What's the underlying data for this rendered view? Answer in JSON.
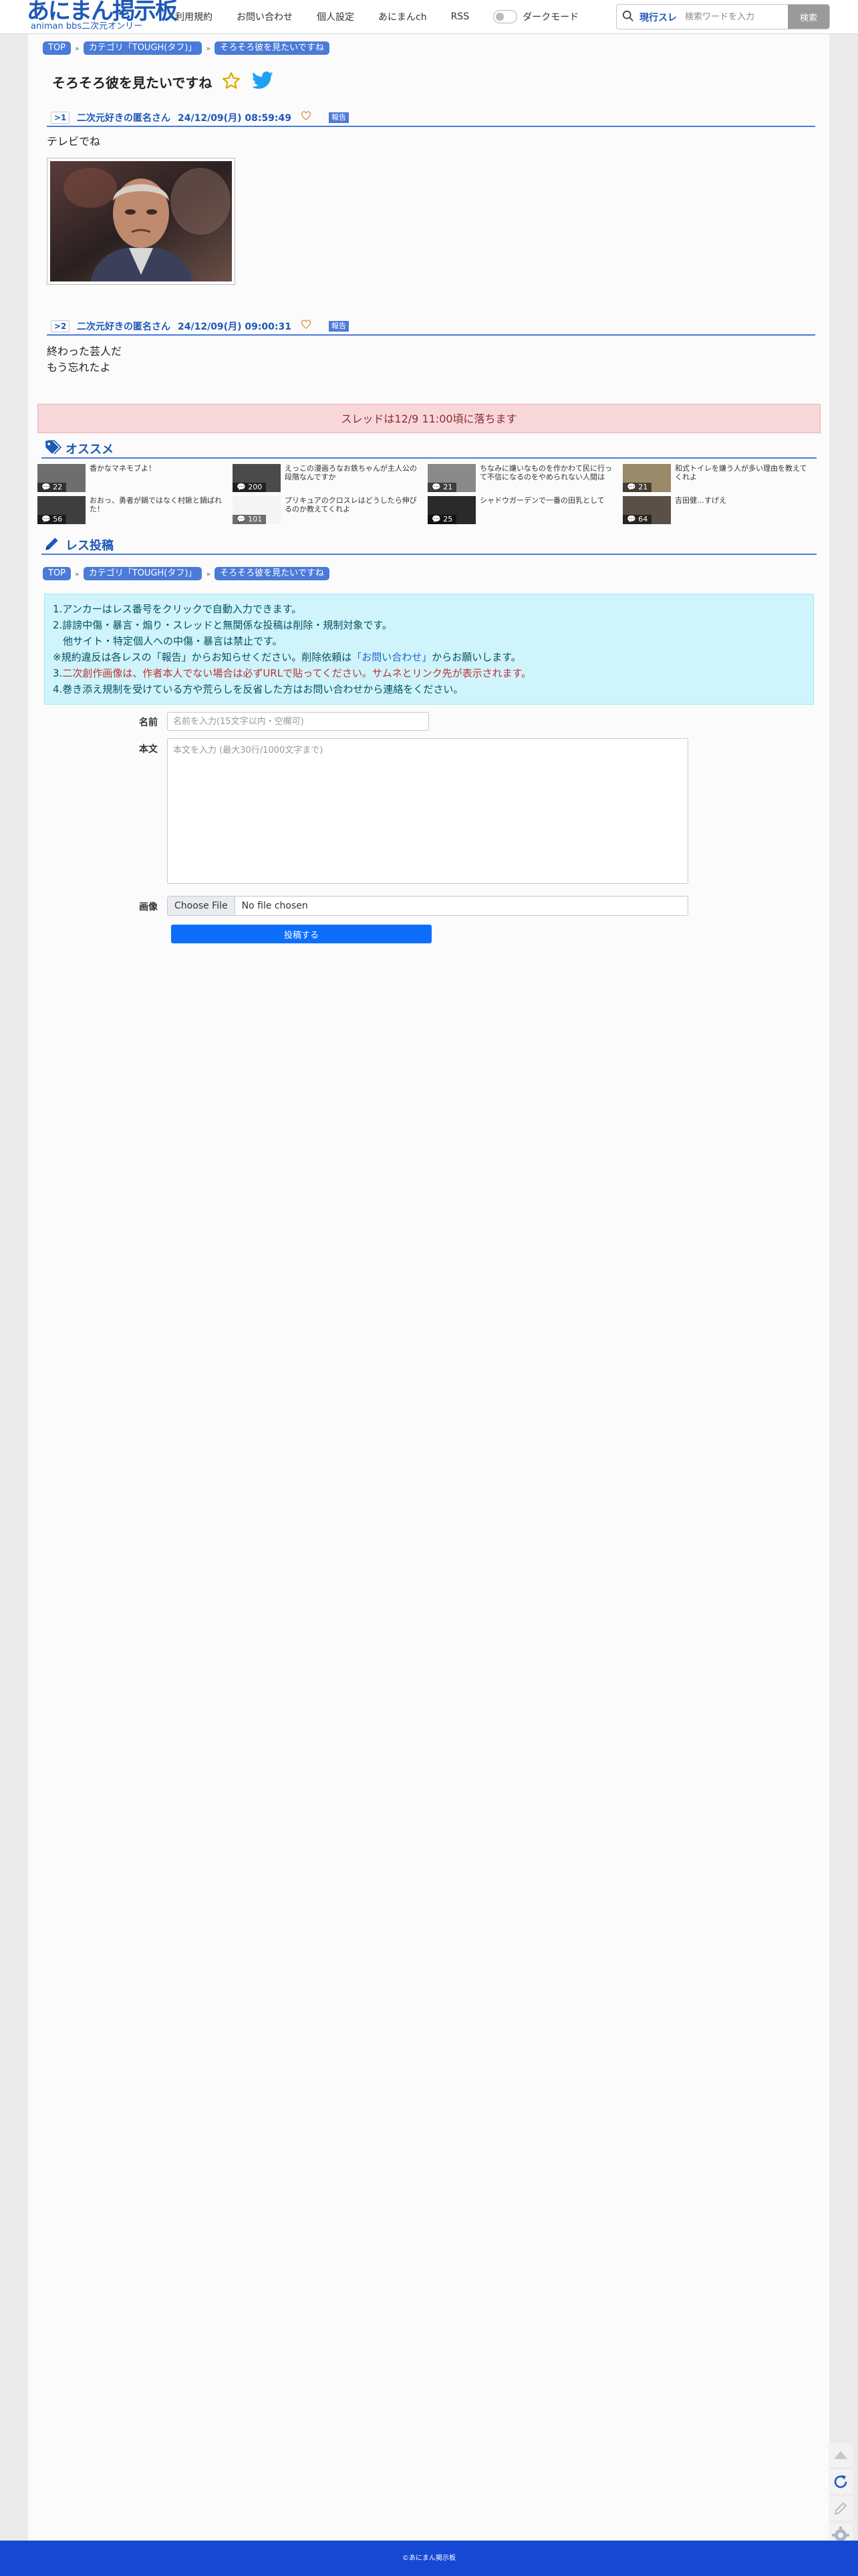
{
  "header": {
    "logo_main": "あにまん掲示板",
    "logo_sub": "animan bbs二次元オンリー",
    "nav": [
      "利用規約",
      "お問い合わせ",
      "個人設定",
      "あにまんch",
      "RSS"
    ],
    "darkmode_label": "ダークモード",
    "search_scope": "現行スレ",
    "search_placeholder": "検索ワードを入力",
    "search_button": "検索"
  },
  "breadcrumb": [
    "TOP",
    "カテゴリ「TOUGH(タフ)」",
    "そろそろ彼を見たいですね"
  ],
  "thread": {
    "title": "そろそろ彼を見たいですね"
  },
  "posts": [
    {
      "no": ">1",
      "name": "二次元好きの匿名さん",
      "date": "24/12/09(月) 08:59:49",
      "report": "報告",
      "lines": [
        "テレビでね"
      ]
    },
    {
      "no": ">2",
      "name": "二次元好きの匿名さん",
      "date": "24/12/09(月) 09:00:31",
      "report": "報告",
      "lines": [
        "終わった芸人だ",
        "もう忘れたよ"
      ]
    }
  ],
  "notice": "スレッドは12/9 11:00頃に落ちます",
  "recommend": {
    "title": "オススメ",
    "items": [
      {
        "title": "香かなマネモブよ！",
        "count": "22"
      },
      {
        "title": "えっこの漫画ろなお鉄ちゃんが主人公の段階なんですか",
        "count": "200"
      },
      {
        "title": "ちなみに嫌いなものを作かわて民に行って不信になるのをやめられない人間は",
        "count": "21"
      },
      {
        "title": "和式トイレを嫌う人が多い理由を教えてくれよ",
        "count": "21"
      },
      {
        "title": "おおっ、勇者が鍋ではなく村鍬と鍋ばれた！",
        "count": "56"
      },
      {
        "title": "プリキュアのクロスレはどうしたら伸びるのか教えてくれよ",
        "count": "101"
      },
      {
        "title": "シャドウガーデンで一番の田乳として",
        "count": "25"
      },
      {
        "title": "吉田健…すげえ",
        "count": "64"
      }
    ]
  },
  "reply": {
    "title": "レス投稿",
    "rules": [
      "1.アンカーはレス番号をクリックで自動入力できます。",
      "2.誹謗中傷・暴言・煽り・スレッドと無関係な投稿は削除・規制対象です。",
      "　他サイト・特定個人への中傷・暴言は禁止です。",
      "※規約違反は各レスの「報告」からお知らせください。削除依頼は「お問い合わせ」からお願いします。",
      "3.二次創作画像は、作者本人でない場合は必ずURLで貼ってください。サムネとリンク先が表示されます。",
      "4.巻き添え規制を受けている方や荒らしを反省した方はお問い合わせから連絡をください。"
    ],
    "rule4_prefix": "※規約違反は各レスの「報告」からお知らせください。削除依頼は",
    "rule4_link": "「お問い合わせ」",
    "rule4_suffix": "からお願いします。",
    "rule5_prefix": "3.",
    "rule5_red": "二次創作画像は、作者本人でない場合は必ずURLで貼ってください。",
    "rule5_teal": "サムネとリンク先が表示されます。",
    "name_label": "名前",
    "name_placeholder": "名前を入力(15文字以内・空欄可)",
    "body_label": "本文",
    "body_placeholder": "本文を入力 (最大30行/1000文字まで)",
    "image_label": "画像",
    "file_button": "Choose File",
    "file_status": "No file chosen",
    "submit": "投稿する"
  },
  "footer": "©あにまん掲示板",
  "colors": {
    "accent": "#1e58b8",
    "crumb": "#4b7bd8",
    "submit": "#0d6efd",
    "footer": "#1648d4"
  }
}
